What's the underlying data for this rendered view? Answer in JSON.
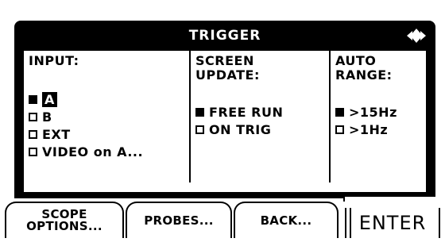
{
  "caption": "",
  "menu": {
    "title": "TRIGGER",
    "nav_icon": "up-down-arrows-icon"
  },
  "input": {
    "heading": "INPUT:",
    "options": [
      {
        "label": "A",
        "selected": true
      },
      {
        "label": "B",
        "selected": false
      },
      {
        "label": "EXT",
        "selected": false
      },
      {
        "label": "VIDEO on A...",
        "selected": false
      }
    ]
  },
  "screen_update": {
    "heading_line1": "SCREEN",
    "heading_line2": "UPDATE:",
    "options": [
      {
        "label": "FREE RUN",
        "selected": true
      },
      {
        "label": "ON TRIG",
        "selected": false
      }
    ]
  },
  "auto_range": {
    "heading_line1": "AUTO",
    "heading_line2": "RANGE:",
    "options": [
      {
        "label": ">15Hz",
        "selected": true
      },
      {
        "label": ">1Hz",
        "selected": false
      }
    ]
  },
  "softkeys": {
    "scope_options_line1": "SCOPE",
    "scope_options_line2": "OPTIONS...",
    "probes": "PROBES...",
    "back": "BACK...",
    "enter": "ENTER"
  }
}
